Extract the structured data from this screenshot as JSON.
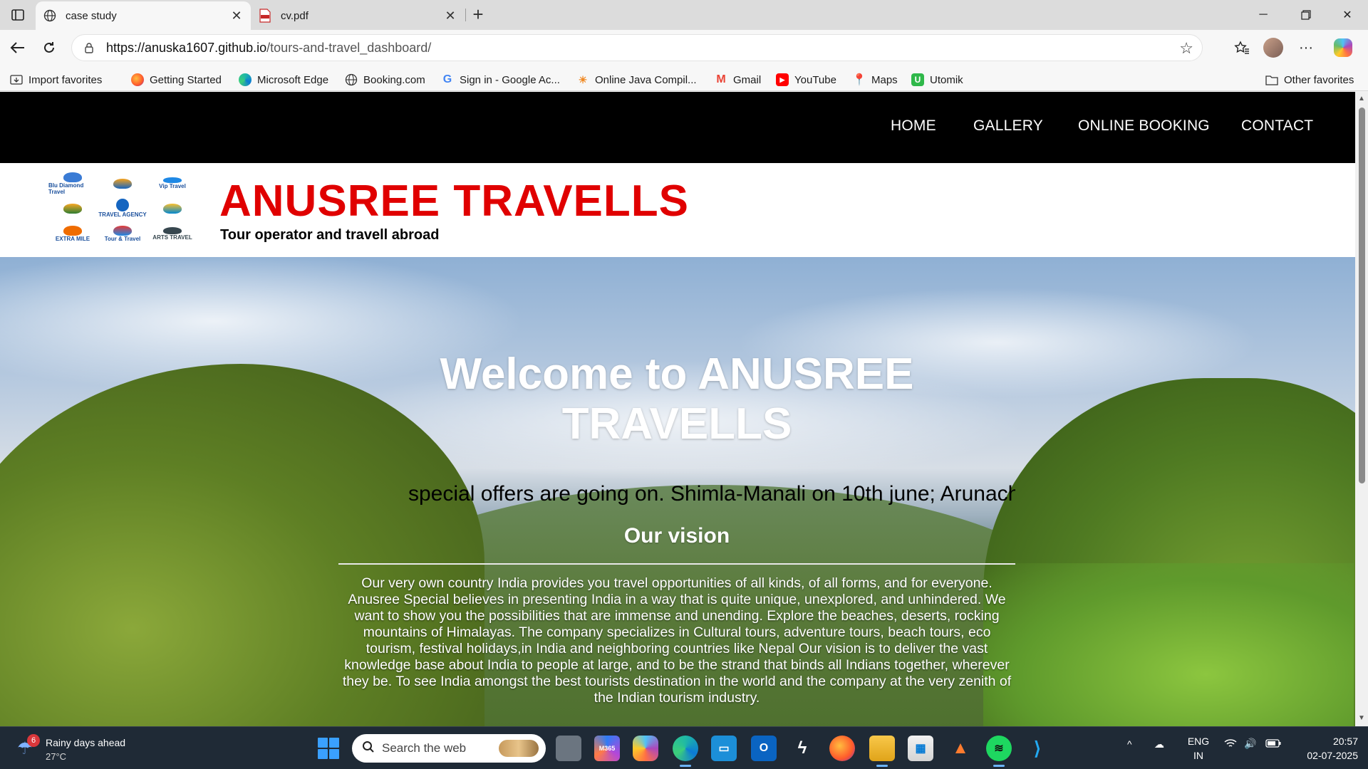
{
  "browser": {
    "tabs": [
      {
        "title": "case study",
        "active": true
      },
      {
        "title": "cv.pdf",
        "active": false
      }
    ],
    "address": {
      "host": "https://anuska1607.github.io",
      "path": "/tours-and-travel_dashboard/"
    },
    "favorites": [
      {
        "label": "Import favorites",
        "icon": "import-icon"
      },
      {
        "label": "Getting Started",
        "icon": "firefox-icon"
      },
      {
        "label": "Microsoft Edge",
        "icon": "edge-icon"
      },
      {
        "label": "Booking.com",
        "icon": "globe-icon"
      },
      {
        "label": "Sign in - Google Ac...",
        "icon": "google-icon"
      },
      {
        "label": "Online Java Compil...",
        "icon": "compiler-icon"
      },
      {
        "label": "Gmail",
        "icon": "gmail-icon"
      },
      {
        "label": "YouTube",
        "icon": "youtube-icon"
      },
      {
        "label": "Maps",
        "icon": "maps-icon"
      },
      {
        "label": "Utomik",
        "icon": "utomik-icon"
      }
    ],
    "other_favorites": "Other favorites"
  },
  "site": {
    "nav": [
      "HOME",
      "GALLERY",
      "ONLINE BOOKING",
      "CONTACT"
    ],
    "brand_title": "ANUSREE TRAVELLS",
    "brand_subtitle": "Tour operator and travell abroad",
    "logos": [
      "Blu Diamond Travel",
      "",
      "Vip Travel",
      "",
      "TRAVEL AGENCY",
      "",
      "EXTRA MILE",
      "Tour & Travel",
      "ARTS TRAVEL"
    ],
    "hero_title": "Welcome to ANUSREE TRAVELLS",
    "marquee": "special offers are going on. Shimla-Manali on 10th june; Arunach",
    "vision_title": "Our vision",
    "vision_text": "Our very own country India provides you travel opportunities of all kinds, of all forms, and for everyone. Anusree Special believes in presenting India in a way that is quite unique, unexplored, and unhindered. We want to show you the possibilities that are immense and unending. Explore the beaches, deserts, rocking mountains of Himalayas. The company specializes in Cultural tours, adventure tours, beach tours, eco tourism, festival holidays,in India and neighboring countries like Nepal Our vision is to deliver the vast knowledge base about India to people at large, and to be the strand that binds all Indians together, wherever they be. To see India amongst the best tourists destination in the world and the company at the very zenith of the Indian tourism industry."
  },
  "taskbar": {
    "weather_badge": "6",
    "weather_line1": "Rainy days ahead",
    "weather_line2": "27°C",
    "search_placeholder": "Search the web",
    "lang_line1": "ENG",
    "lang_line2": "IN",
    "time": "20:57",
    "date": "02-07-2025",
    "apps": [
      "task-view",
      "m365",
      "copilot",
      "edge",
      "remote-desktop",
      "outlook",
      "cursor",
      "firefox",
      "file-explorer",
      "store",
      "matlab",
      "spotify",
      "vscode"
    ]
  },
  "colors": {
    "brand_red": "#e00000",
    "nav_bg": "#000000",
    "taskbar_bg": "#1f2a36"
  }
}
